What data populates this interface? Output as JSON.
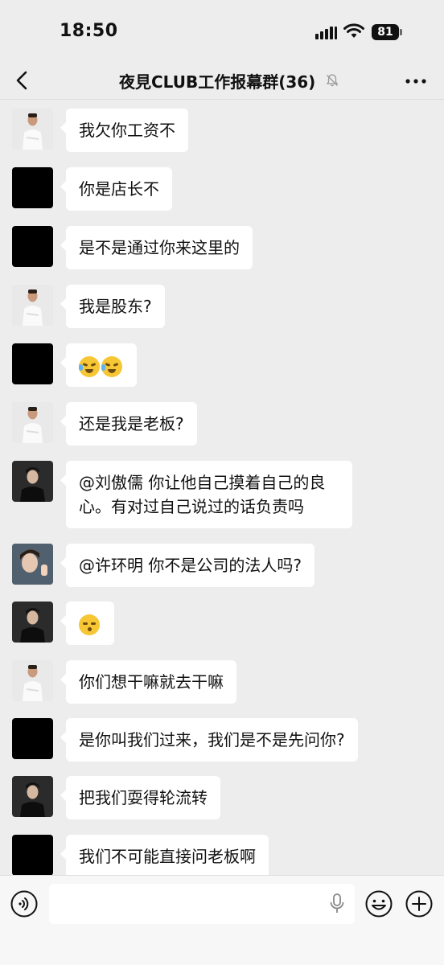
{
  "status_bar": {
    "time": "18:50",
    "battery": "81"
  },
  "header": {
    "title": "夜見CLUB工作报幕群(36)"
  },
  "messages": [
    {
      "avatar": "woman",
      "text": "我欠你工资不"
    },
    {
      "avatar": "black",
      "text": "你是店长不"
    },
    {
      "avatar": "black",
      "text": "是不是通过你来这里的"
    },
    {
      "avatar": "woman",
      "text": "我是股东?"
    },
    {
      "avatar": "black",
      "text": ""
    },
    {
      "avatar": "woman",
      "text": "还是我是老板?"
    },
    {
      "avatar": "man",
      "text": "@刘傲儒 你让他自己摸着自己的良心。有对过自己说过的话负责吗"
    },
    {
      "avatar": "kid",
      "text": "@许环明 你不是公司的法人吗?"
    },
    {
      "avatar": "man",
      "text": ""
    },
    {
      "avatar": "woman",
      "text": "你们想干嘛就去干嘛"
    },
    {
      "avatar": "black",
      "text": "是你叫我们过来，我们是不是先问你?"
    },
    {
      "avatar": "man",
      "text": "把我们耍得轮流转"
    },
    {
      "avatar": "black",
      "text": "我们不可能直接问老板啊"
    }
  ],
  "emoji_messages": {
    "msg_4": [
      "crying-laughing-emoji",
      "crying-laughing-emoji"
    ],
    "msg_8": [
      "kissing-face-emoji"
    ]
  },
  "input": {
    "placeholder": ""
  },
  "colors": {
    "background": "#ededed",
    "bubble": "#ffffff",
    "input_bar": "#f7f7f7"
  }
}
